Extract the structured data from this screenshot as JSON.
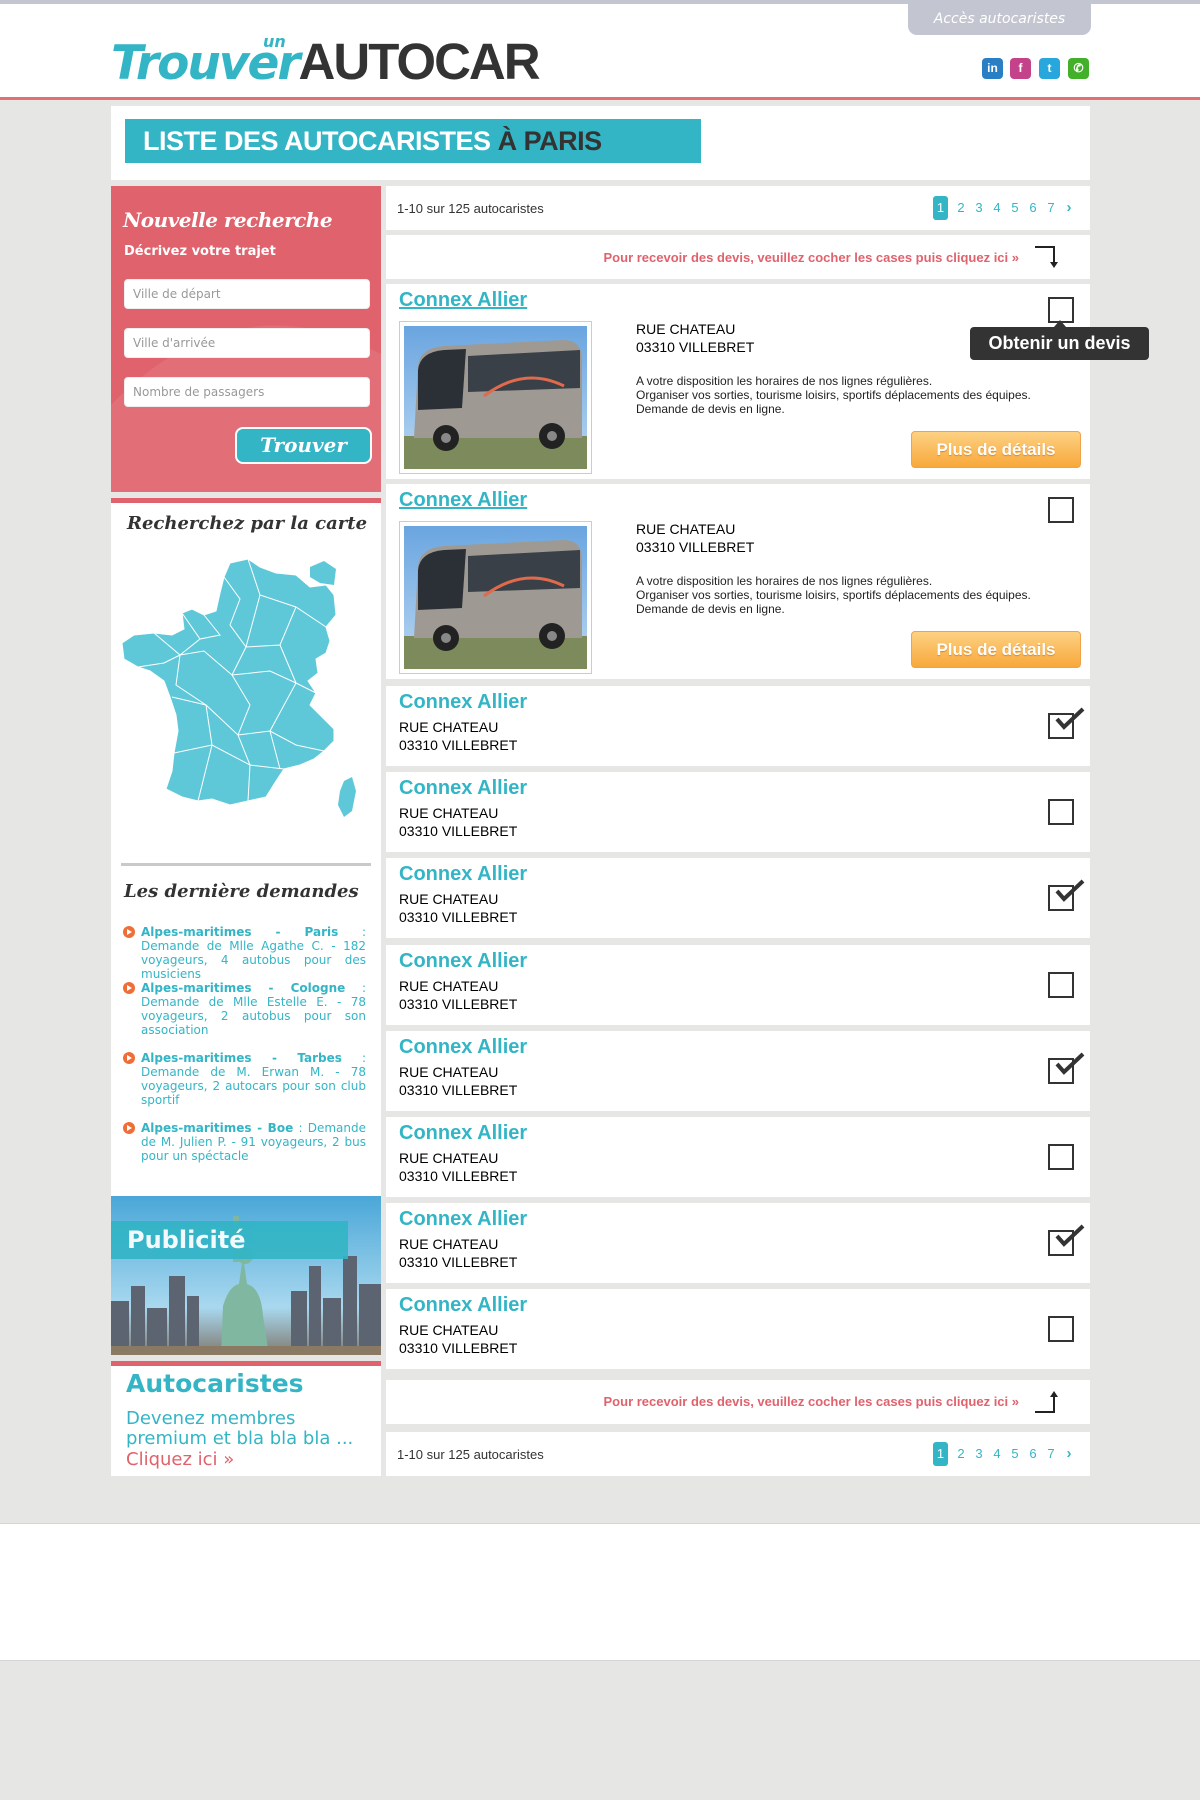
{
  "header": {
    "access_label": "Accès autocaristes",
    "logo": {
      "trouver": "Trouver",
      "un": "un",
      "autocar": "AUTOCAR"
    },
    "social": [
      {
        "icon": "linkedin-icon",
        "glyph": "in",
        "color": "#2a7ec4"
      },
      {
        "icon": "facebook-icon",
        "glyph": "f",
        "color": "#c3428a"
      },
      {
        "icon": "twitter-icon",
        "glyph": "t",
        "color": "#27a7dc"
      },
      {
        "icon": "chat-icon",
        "glyph": "✆",
        "color": "#43b02a"
      }
    ]
  },
  "page_title": {
    "part1": "LISTE DES AUTOCARISTES",
    "part2": "À PARIS"
  },
  "search": {
    "title": "Nouvelle recherche",
    "subtitle": "Décrivez votre trajet",
    "departure_placeholder": "Ville de départ",
    "arrival_placeholder": "Ville d'arrivée",
    "passengers_placeholder": "Nombre de passagers",
    "submit_label": "Trouver"
  },
  "map": {
    "title": "Recherchez par la carte"
  },
  "demandes": {
    "title": "Les dernière demandes",
    "items": [
      {
        "route": "Alpes-maritimes - Paris",
        "text": " : Demande de Mlle Agathe C. - 182 voyageurs, 4 autobus pour des musiciens"
      },
      {
        "route": "Alpes-maritimes - Cologne",
        "text": " : Demande de Mlle Estelle E. - 78 voyageurs, 2 autobus pour son association"
      },
      {
        "route": "Alpes-maritimes - Tarbes",
        "text": " : Demande de M. Erwan M. - 78 voyageurs, 2 autocars pour son club sportif"
      },
      {
        "route": "Alpes-maritimes - Boe",
        "text": " : Demande de M. Julien P. - 91 voyageurs, 2 bus pour un spéctacle"
      }
    ]
  },
  "pub": {
    "label": "Publicité"
  },
  "autocaristes": {
    "title": "Autocaristes",
    "text": "Devenez membres premium et bla bla bla ...",
    "link": "Cliquez ici »"
  },
  "pagination": {
    "summary": "1-10 sur 125 autocaristes",
    "pages": [
      "1",
      "2",
      "3",
      "4",
      "5",
      "6",
      "7"
    ],
    "current": "1",
    "next": "›"
  },
  "cta": "Pour recevoir des devis, veuillez cocher les cases puis cliquez ici »",
  "tooltip": "Obtenir un devis",
  "details_label": "Plus de détails",
  "featured": [
    {
      "name": "Connex Allier",
      "street": "RUE CHATEAU",
      "city": "03310 VILLEBRET",
      "desc1": "A votre disposition les horaires de nos lignes régulières.",
      "desc2": "Organiser vos sorties, tourisme loisirs, sportifs déplacements des équipes.",
      "desc3": "Demande de devis en ligne.",
      "checked": false
    },
    {
      "name": "Connex Allier",
      "street": "RUE CHATEAU",
      "city": "03310 VILLEBRET",
      "desc1": "A votre disposition les horaires de nos lignes régulières.",
      "desc2": "Organiser vos sorties, tourisme loisirs, sportifs déplacements des équipes.",
      "desc3": "Demande de devis en ligne.",
      "checked": false
    }
  ],
  "simple": [
    {
      "name": "Connex Allier",
      "street": "RUE CHATEAU",
      "city": "03310 VILLEBRET",
      "checked": true
    },
    {
      "name": "Connex Allier",
      "street": "RUE CHATEAU",
      "city": "03310 VILLEBRET",
      "checked": false
    },
    {
      "name": "Connex Allier",
      "street": "RUE CHATEAU",
      "city": "03310 VILLEBRET",
      "checked": true
    },
    {
      "name": "Connex Allier",
      "street": "RUE CHATEAU",
      "city": "03310 VILLEBRET",
      "checked": false
    },
    {
      "name": "Connex Allier",
      "street": "RUE CHATEAU",
      "city": "03310 VILLEBRET",
      "checked": true
    },
    {
      "name": "Connex Allier",
      "street": "RUE CHATEAU",
      "city": "03310 VILLEBRET",
      "checked": false
    },
    {
      "name": "Connex Allier",
      "street": "RUE CHATEAU",
      "city": "03310 VILLEBRET",
      "checked": true
    },
    {
      "name": "Connex Allier",
      "street": "RUE CHATEAU",
      "city": "03310 VILLEBRET",
      "checked": false
    }
  ],
  "colors": {
    "accent": "#33b5c6",
    "brand_red": "#e0626c",
    "orange": "#f8a83a"
  }
}
